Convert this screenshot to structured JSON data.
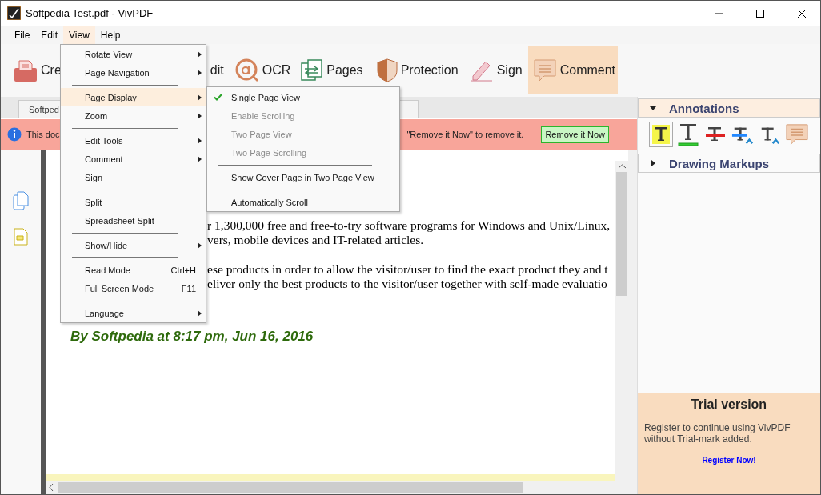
{
  "window": {
    "title": "Softpedia Test.pdf - VivPDF"
  },
  "menu_bar": [
    {
      "label": "File",
      "selected": false
    },
    {
      "label": "Edit",
      "selected": false
    },
    {
      "label": "View",
      "selected": true
    },
    {
      "label": "Help",
      "selected": false
    }
  ],
  "toolbar": [
    {
      "kind": "create",
      "label": "Cre",
      "selected": false
    },
    {
      "kind": "edit",
      "label": "dit",
      "selected": false
    },
    {
      "kind": "ocr",
      "label": "OCR",
      "selected": false
    },
    {
      "kind": "pages",
      "label": "Pages",
      "selected": false
    },
    {
      "kind": "protection",
      "label": "Protection",
      "selected": false
    },
    {
      "kind": "sign",
      "label": "Sign",
      "selected": false
    },
    {
      "kind": "comment",
      "label": "Comment",
      "selected": true
    }
  ],
  "tabs": [
    {
      "label": "Softped",
      "selected": true
    }
  ],
  "notice": {
    "text_start": "This doc",
    "text_end": "\"Remove it Now\" to remove it.",
    "button": "Remove it Now"
  },
  "document": {
    "lines": [
      "r 1,300,000 free and free-to-try software programs for Windows and Unix/Linux,",
      "vers, mobile devices and IT-related articles.",
      "ese products in order to allow the visitor/user to find the exact product they and t",
      "eliver only the best products to the visitor/user together with self-made evaluatio"
    ],
    "byline": "By Softpedia at 8:17 pm, Jun 16, 2016"
  },
  "view_menu": {
    "items": [
      {
        "kind": "item",
        "label": "Rotate View",
        "submenu": true,
        "selected": false
      },
      {
        "kind": "item",
        "label": "Page Navigation",
        "submenu": true,
        "selected": false
      },
      {
        "kind": "separator"
      },
      {
        "kind": "item",
        "label": "Page Display",
        "submenu": true,
        "selected": true
      },
      {
        "kind": "item",
        "label": "Zoom",
        "submenu": true,
        "selected": false
      },
      {
        "kind": "separator"
      },
      {
        "kind": "item",
        "label": "Edit Tools",
        "submenu": true,
        "selected": false
      },
      {
        "kind": "item",
        "label": "Comment",
        "submenu": true,
        "selected": false
      },
      {
        "kind": "item",
        "label": "Sign",
        "submenu": false,
        "selected": false
      },
      {
        "kind": "separator"
      },
      {
        "kind": "item",
        "label": "Split",
        "submenu": false,
        "selected": false
      },
      {
        "kind": "item",
        "label": "Spreadsheet Split",
        "submenu": false,
        "selected": false
      },
      {
        "kind": "separator"
      },
      {
        "kind": "item",
        "label": "Show/Hide",
        "submenu": true,
        "selected": false
      },
      {
        "kind": "separator"
      },
      {
        "kind": "item",
        "label": "Read Mode",
        "shortcut": "Ctrl+H",
        "submenu": false,
        "selected": false
      },
      {
        "kind": "item",
        "label": "Full Screen Mode",
        "shortcut": "F11",
        "submenu": false,
        "selected": false
      },
      {
        "kind": "separator"
      },
      {
        "kind": "item",
        "label": "Language",
        "submenu": true,
        "selected": false
      }
    ]
  },
  "page_display_menu": {
    "items": [
      {
        "kind": "item",
        "label": "Single Page View",
        "checked": true,
        "disabled": false
      },
      {
        "kind": "item",
        "label": "Enable Scrolling",
        "checked": false,
        "disabled": true
      },
      {
        "kind": "item",
        "label": "Two Page View",
        "checked": false,
        "disabled": true
      },
      {
        "kind": "item",
        "label": "Two Page Scrolling",
        "checked": false,
        "disabled": true
      },
      {
        "kind": "separator"
      },
      {
        "kind": "item",
        "label": "Show Cover Page in Two Page View",
        "checked": false,
        "disabled": false
      },
      {
        "kind": "separator"
      },
      {
        "kind": "item",
        "label": "Automatically Scroll",
        "checked": false,
        "disabled": false
      }
    ]
  },
  "side_panel": {
    "sections": [
      {
        "label": "Annotations",
        "expanded": true
      },
      {
        "label": "Drawing Markups",
        "expanded": false
      }
    ],
    "annotation_tools": [
      {
        "kind": "highlight",
        "selected": true
      },
      {
        "kind": "underline",
        "selected": false
      },
      {
        "kind": "strikeout",
        "selected": false
      },
      {
        "kind": "replace",
        "selected": false
      },
      {
        "kind": "insert",
        "selected": false
      },
      {
        "kind": "note",
        "selected": false
      }
    ],
    "trial": {
      "title": "Trial version",
      "text": "Register to continue using VivPDF without Trial-mark added.",
      "link": "Register Now!"
    }
  }
}
